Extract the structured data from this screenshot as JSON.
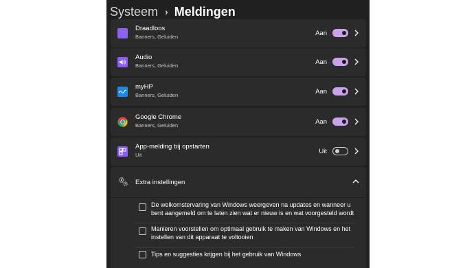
{
  "breadcrumb": {
    "parent": "Systeem",
    "separator": "›",
    "current": "Meldingen"
  },
  "apps": [
    {
      "name": "Draadloos",
      "subtitle": "Banners, Geluiden",
      "state": "Aan",
      "toggle_on": true,
      "icon": "wireless-app-icon",
      "icon_color": "#8a63f0"
    },
    {
      "name": "Audio",
      "subtitle": "Banners, Geluiden",
      "state": "Aan",
      "toggle_on": true,
      "icon": "audio-app-icon",
      "icon_color": "#8b5cf6"
    },
    {
      "name": "myHP",
      "subtitle": "Banners, Geluiden",
      "state": "Aan",
      "toggle_on": true,
      "icon": "myhp-app-icon",
      "icon_color": "#1e88e5"
    },
    {
      "name": "Google Chrome",
      "subtitle": "Banners, Geluiden",
      "state": "Aan",
      "toggle_on": true,
      "icon": "chrome-app-icon",
      "icon_color": "#ea4335"
    },
    {
      "name": "App-melding bij opstarten",
      "subtitle": "Uit",
      "state": "Uit",
      "toggle_on": false,
      "icon": "startup-app-icon",
      "icon_color": "#8b5cf6"
    }
  ],
  "extra": {
    "title": "Extra instellingen",
    "options": [
      {
        "label": "De welkomstervaring van Windows weergeven na updates en wanneer u bent aangemeld om te laten zien wat er nieuw is en wat voorgesteld wordt",
        "checked": false
      },
      {
        "label": "Manieren voorstellen om optimaal gebruik te maken van Windows en het instellen van dit apparaat te voltooien",
        "checked": false
      },
      {
        "label": "Tips en suggesties krijgen bij het gebruik van Windows",
        "checked": false
      }
    ]
  },
  "colors": {
    "panel_bg": "#202020",
    "row_bg": "#2b2b2b",
    "accent": "#c9a2ea"
  }
}
